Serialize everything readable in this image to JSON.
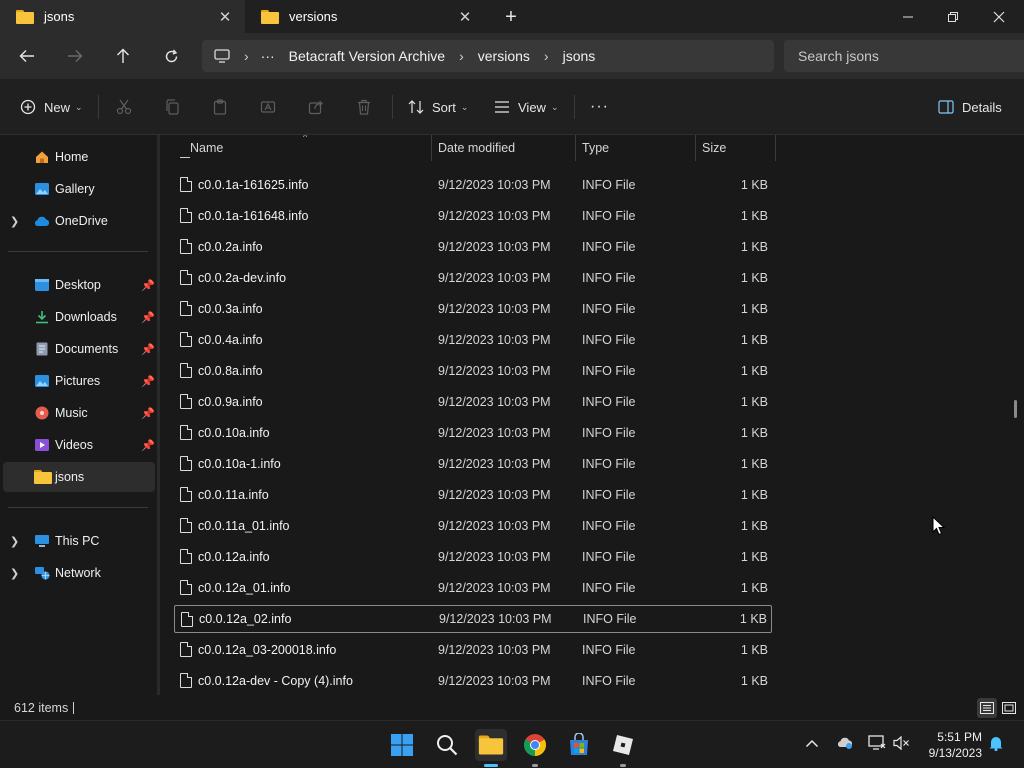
{
  "tabs": [
    {
      "title": "jsons",
      "active": true
    },
    {
      "title": "versions",
      "active": false
    }
  ],
  "address": {
    "ellipsis": "···",
    "segments": [
      "Betacraft Version Archive",
      "versions",
      "jsons"
    ]
  },
  "search": {
    "placeholder": "Search jsons"
  },
  "commands": {
    "new_label": "New",
    "sort_label": "Sort",
    "view_label": "View",
    "more_label": "···",
    "details_label": "Details"
  },
  "sidebar": {
    "items": [
      {
        "label": "Home",
        "icon": "home-icon"
      },
      {
        "label": "Gallery",
        "icon": "gallery-icon"
      },
      {
        "label": "OneDrive",
        "icon": "onedrive-icon"
      },
      {
        "label": "Desktop",
        "icon": "desktop-icon",
        "pinned": true
      },
      {
        "label": "Downloads",
        "icon": "downloads-icon",
        "pinned": true
      },
      {
        "label": "Documents",
        "icon": "documents-icon",
        "pinned": true
      },
      {
        "label": "Pictures",
        "icon": "pictures-icon",
        "pinned": true
      },
      {
        "label": "Music",
        "icon": "music-icon",
        "pinned": true
      },
      {
        "label": "Videos",
        "icon": "videos-icon",
        "pinned": true
      },
      {
        "label": "jsons",
        "icon": "folder-icon",
        "selected": true
      },
      {
        "label": "This PC",
        "icon": "this-pc-icon"
      },
      {
        "label": "Network",
        "icon": "network-icon"
      }
    ]
  },
  "columns": {
    "name": "Name",
    "date": "Date modified",
    "type": "Type",
    "size": "Size"
  },
  "files": [
    {
      "name": "c0.0.1a-161625.info",
      "date": "9/12/2023 10:03 PM",
      "type": "INFO File",
      "size": "1 KB"
    },
    {
      "name": "c0.0.1a-161648.info",
      "date": "9/12/2023 10:03 PM",
      "type": "INFO File",
      "size": "1 KB"
    },
    {
      "name": "c0.0.2a.info",
      "date": "9/12/2023 10:03 PM",
      "type": "INFO File",
      "size": "1 KB"
    },
    {
      "name": "c0.0.2a-dev.info",
      "date": "9/12/2023 10:03 PM",
      "type": "INFO File",
      "size": "1 KB"
    },
    {
      "name": "c0.0.3a.info",
      "date": "9/12/2023 10:03 PM",
      "type": "INFO File",
      "size": "1 KB"
    },
    {
      "name": "c0.0.4a.info",
      "date": "9/12/2023 10:03 PM",
      "type": "INFO File",
      "size": "1 KB"
    },
    {
      "name": "c0.0.8a.info",
      "date": "9/12/2023 10:03 PM",
      "type": "INFO File",
      "size": "1 KB"
    },
    {
      "name": "c0.0.9a.info",
      "date": "9/12/2023 10:03 PM",
      "type": "INFO File",
      "size": "1 KB"
    },
    {
      "name": "c0.0.10a.info",
      "date": "9/12/2023 10:03 PM",
      "type": "INFO File",
      "size": "1 KB"
    },
    {
      "name": "c0.0.10a-1.info",
      "date": "9/12/2023 10:03 PM",
      "type": "INFO File",
      "size": "1 KB"
    },
    {
      "name": "c0.0.11a.info",
      "date": "9/12/2023 10:03 PM",
      "type": "INFO File",
      "size": "1 KB"
    },
    {
      "name": "c0.0.11a_01.info",
      "date": "9/12/2023 10:03 PM",
      "type": "INFO File",
      "size": "1 KB"
    },
    {
      "name": "c0.0.12a.info",
      "date": "9/12/2023 10:03 PM",
      "type": "INFO File",
      "size": "1 KB"
    },
    {
      "name": "c0.0.12a_01.info",
      "date": "9/12/2023 10:03 PM",
      "type": "INFO File",
      "size": "1 KB"
    },
    {
      "name": "c0.0.12a_02.info",
      "date": "9/12/2023 10:03 PM",
      "type": "INFO File",
      "size": "1 KB",
      "focused": true
    },
    {
      "name": "c0.0.12a_03-200018.info",
      "date": "9/12/2023 10:03 PM",
      "type": "INFO File",
      "size": "1 KB"
    },
    {
      "name": "c0.0.12a-dev - Copy (4).info",
      "date": "9/12/2023 10:03 PM",
      "type": "INFO File",
      "size": "1 KB"
    }
  ],
  "status": {
    "item_count": "612 items"
  },
  "clock": {
    "time": "5:51 PM",
    "date": "9/13/2023"
  },
  "colors": {
    "folder": "#f7c43c",
    "accent": "#4cc2ff",
    "background": "#191919"
  }
}
